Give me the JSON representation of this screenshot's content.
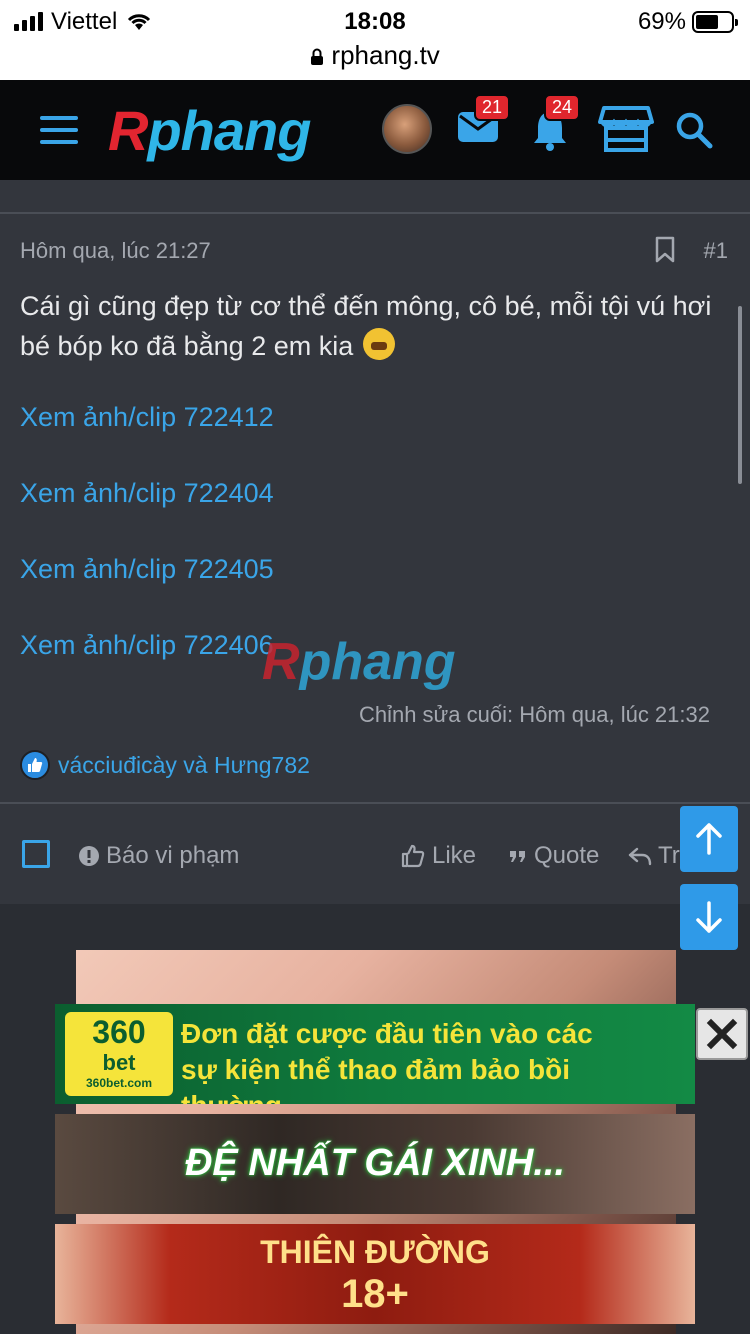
{
  "status_bar": {
    "carrier": "Viettel",
    "time": "18:08",
    "battery": "69%",
    "url": "rphang.tv"
  },
  "navbar": {
    "logo_first": "R",
    "logo_rest": "phang",
    "messages_count": "21",
    "alerts_count": "24",
    "accent_color": "#3aa5e8"
  },
  "post": {
    "date": "Hôm qua, lúc 21:27",
    "number": "#1",
    "text": "Cái gì cũng đẹp từ cơ thể đến mông, cô bé, mỗi tội vú hơi bé bóp ko đã bằng 2 em kia",
    "links": [
      "Xem ảnh/clip 722412",
      "Xem ảnh/clip 722404",
      "Xem ảnh/clip 722405",
      "Xem ảnh/clip 722406"
    ],
    "watermark_first": "R",
    "watermark_rest": "phang",
    "edited": "Chỉnh sửa cuối: Hôm qua, lúc 21:32",
    "reactions": "vácciuđicày và Hưng782"
  },
  "actions": {
    "report": "Báo vi phạm",
    "like": "Like",
    "quote": "Quote",
    "reply": "Tr"
  },
  "ads": {
    "ad1_logo_num": "360",
    "ad1_logo_bet": "bet",
    "ad1_logo_domain": "360bet.com",
    "ad1_text": "Đơn đặt cược đầu tiên vào các sự kiện thể thao đảm bảo bồi thường",
    "ad2_text": "ĐỆ NHẤT GÁI XINH...",
    "ad3_line1": "THIÊN ĐƯỜNG",
    "ad3_line2": "18+"
  }
}
